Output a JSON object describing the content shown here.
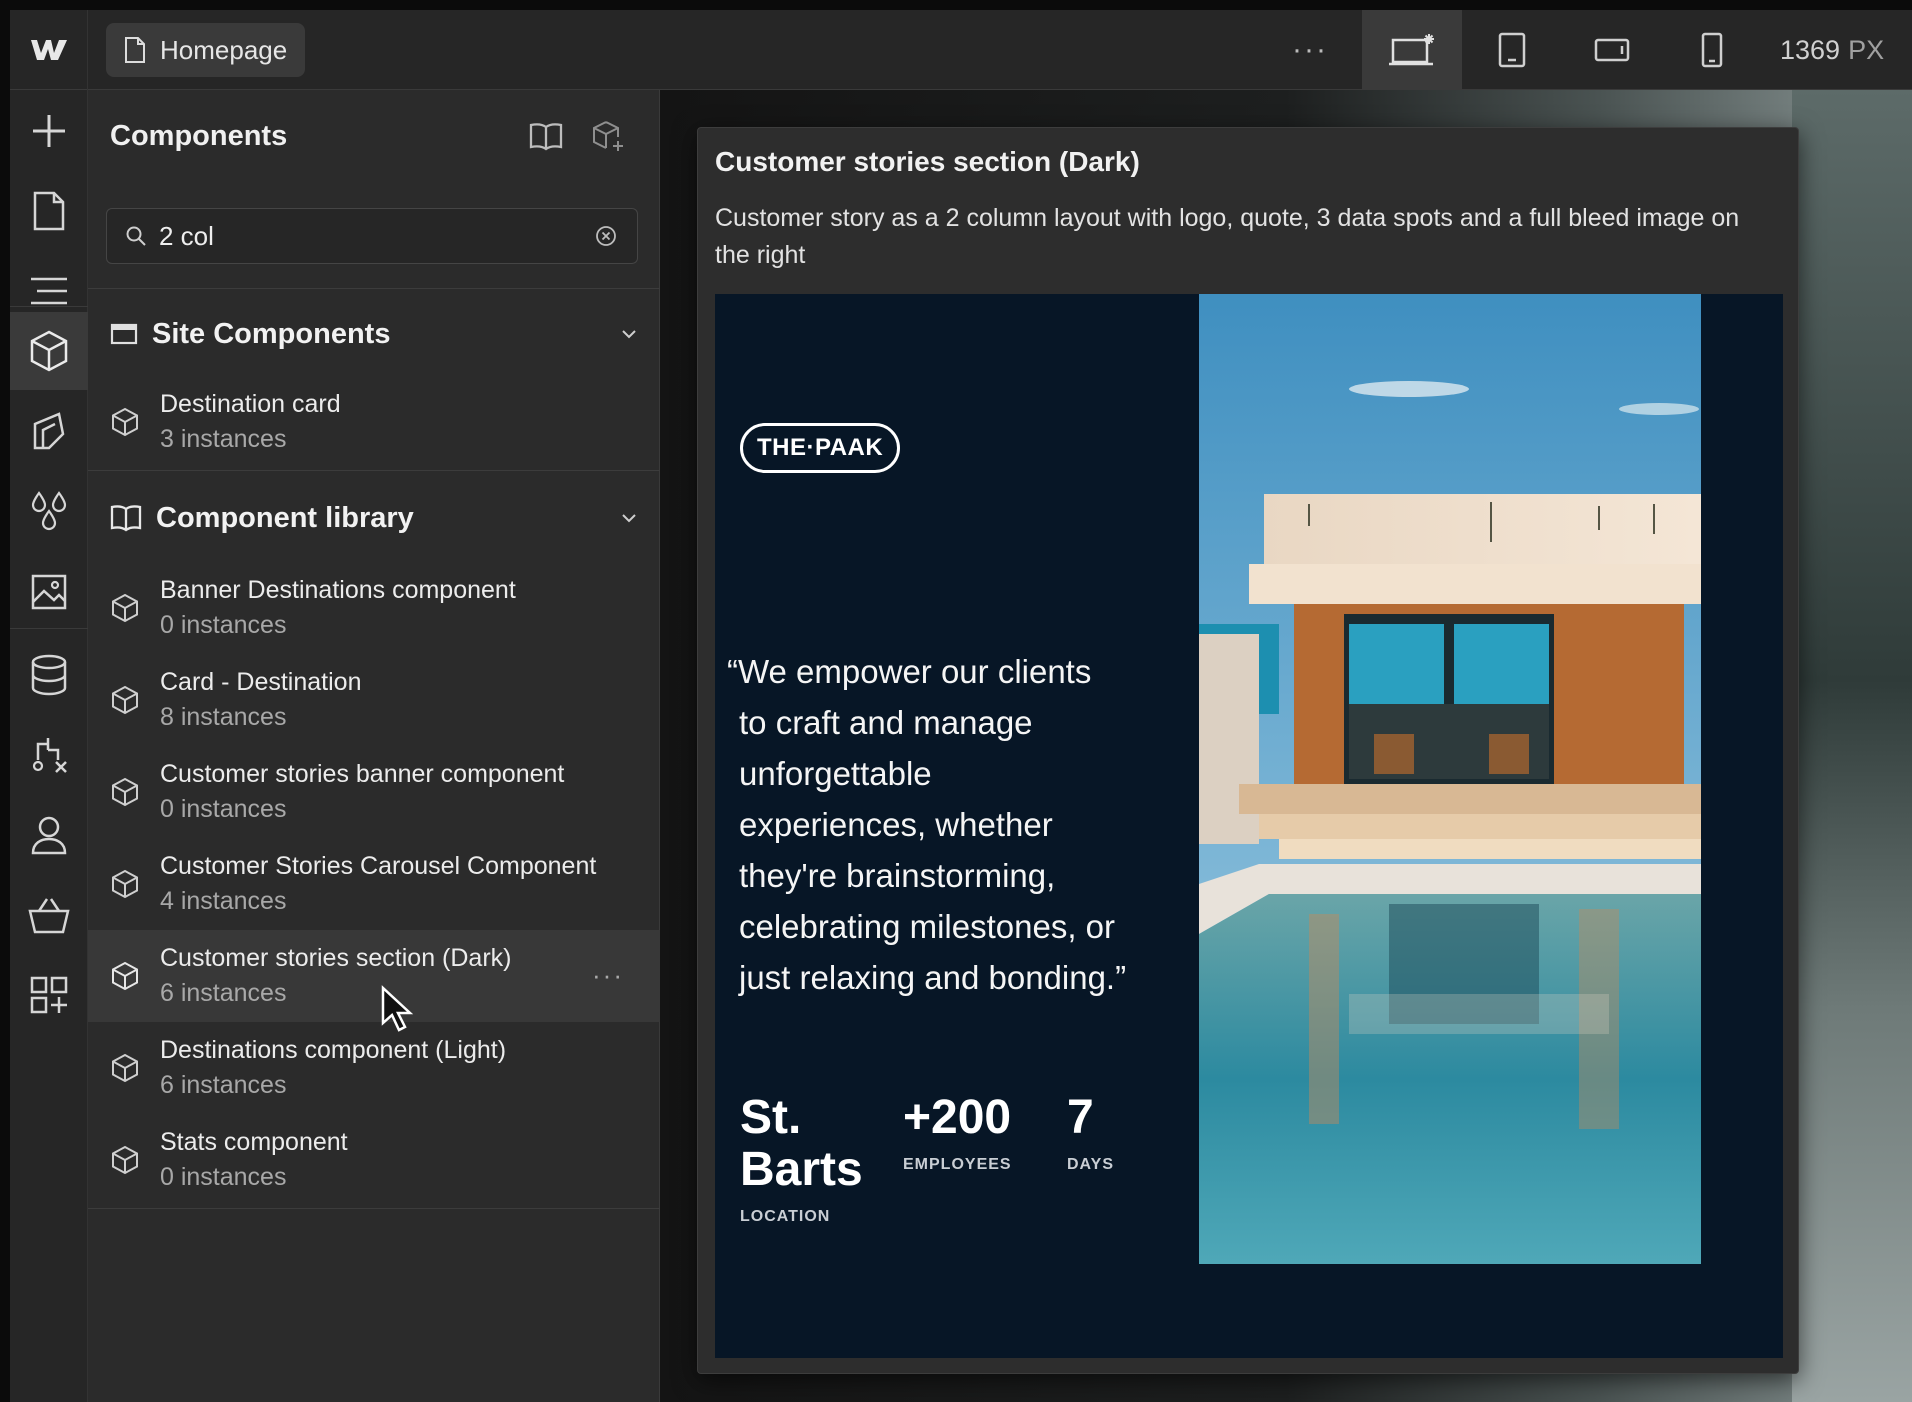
{
  "topbar": {
    "page_name": "Homepage",
    "more_label": "···",
    "width_value": "1369",
    "width_unit": "PX"
  },
  "rail": {
    "items": [
      "add-icon",
      "pages-icon",
      "navigator-icon",
      "components-icon",
      "style-selector-icon",
      "variables-icon",
      "assets-icon",
      "cms-icon",
      "logic-icon",
      "users-icon",
      "ecommerce-icon",
      "apps-icon"
    ]
  },
  "panel": {
    "title": "Components",
    "search": {
      "value": "2 col",
      "placeholder": "Search"
    },
    "site_components": {
      "label": "Site Components",
      "items": [
        {
          "name": "Destination card",
          "count": "3 instances"
        }
      ]
    },
    "library": {
      "label": "Component library",
      "items": [
        {
          "name": "Banner Destinations component",
          "count": "0 instances"
        },
        {
          "name": "Card - Destination",
          "count": "8 instances"
        },
        {
          "name": "Customer stories banner component",
          "count": "0 instances"
        },
        {
          "name": "Customer Stories Carousel Component",
          "count": "4 instances"
        },
        {
          "name": "Customer stories section (Dark)",
          "count": "6 instances"
        },
        {
          "name": "Destinations component (Light)",
          "count": "6 instances"
        },
        {
          "name": "Stats component",
          "count": "0 instances"
        }
      ],
      "more_label": "···"
    }
  },
  "preview": {
    "title": "Customer stories section (Dark)",
    "description": "Customer story as a 2 column layout with logo, quote, 3 data spots and a full bleed image on the right",
    "brand": "THE·PAAK",
    "quote": "“We empower our clients to craft and manage unforgettable experiences, whether they're brainstorming, celebrating milestones, or just relaxing and bonding.”",
    "stats": [
      {
        "value": "St. Barts",
        "label": "LOCATION"
      },
      {
        "value": "+200",
        "label": "EMPLOYEES"
      },
      {
        "value": "7",
        "label": "DAYS"
      }
    ]
  },
  "colors": {
    "panel_bg": "#2b2b2b",
    "topbar_bg": "#262626",
    "preview_frame_bg": "#071626",
    "hover_row": "#383838"
  }
}
